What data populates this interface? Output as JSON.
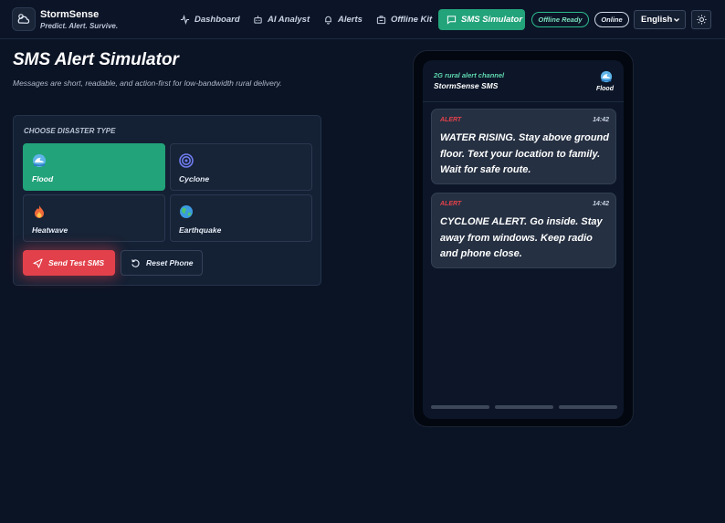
{
  "brand": {
    "name": "StormSense",
    "tagline": "Predict. Alert. Survive."
  },
  "nav": {
    "items": [
      {
        "label": "Dashboard",
        "icon": "activity-icon"
      },
      {
        "label": "AI Analyst",
        "icon": "robot-icon"
      },
      {
        "label": "Alerts",
        "icon": "bell-icon"
      },
      {
        "label": "Offline Kit",
        "icon": "kit-icon"
      },
      {
        "label": "SMS Simulator",
        "icon": "message-icon",
        "active": true
      }
    ],
    "status_offline": "Offline Ready",
    "status_online": "Online",
    "language": "English",
    "theme_icon": "sun-icon"
  },
  "page": {
    "title": "SMS Alert Simulator",
    "description": "Messages are short, readable, and action-first for low-bandwidth rural delivery."
  },
  "disaster_panel": {
    "label": "CHOOSE DISASTER TYPE",
    "options": [
      {
        "label": "Flood",
        "icon": "wave-icon",
        "selected": true
      },
      {
        "label": "Cyclone",
        "icon": "cyclone-icon",
        "selected": false
      },
      {
        "label": "Heatwave",
        "icon": "fire-icon",
        "selected": false
      },
      {
        "label": "Earthquake",
        "icon": "globe-icon",
        "selected": false
      }
    ],
    "send_label": "Send Test SMS",
    "reset_label": "Reset Phone"
  },
  "phone": {
    "channel": "2G rural alert channel",
    "sender": "StormSense SMS",
    "current_type": "Flood",
    "messages": [
      {
        "tag": "ALERT",
        "time": "14:42",
        "text": "WATER RISING. Stay above ground floor. Text your location to family. Wait for safe route."
      },
      {
        "tag": "ALERT",
        "time": "14:42",
        "text": "CYCLONE ALERT. Go inside. Stay away from windows. Keep radio and phone close."
      }
    ]
  },
  "colors": {
    "accent": "#22a37a",
    "alert": "#e2414b",
    "background": "#0b1425"
  }
}
